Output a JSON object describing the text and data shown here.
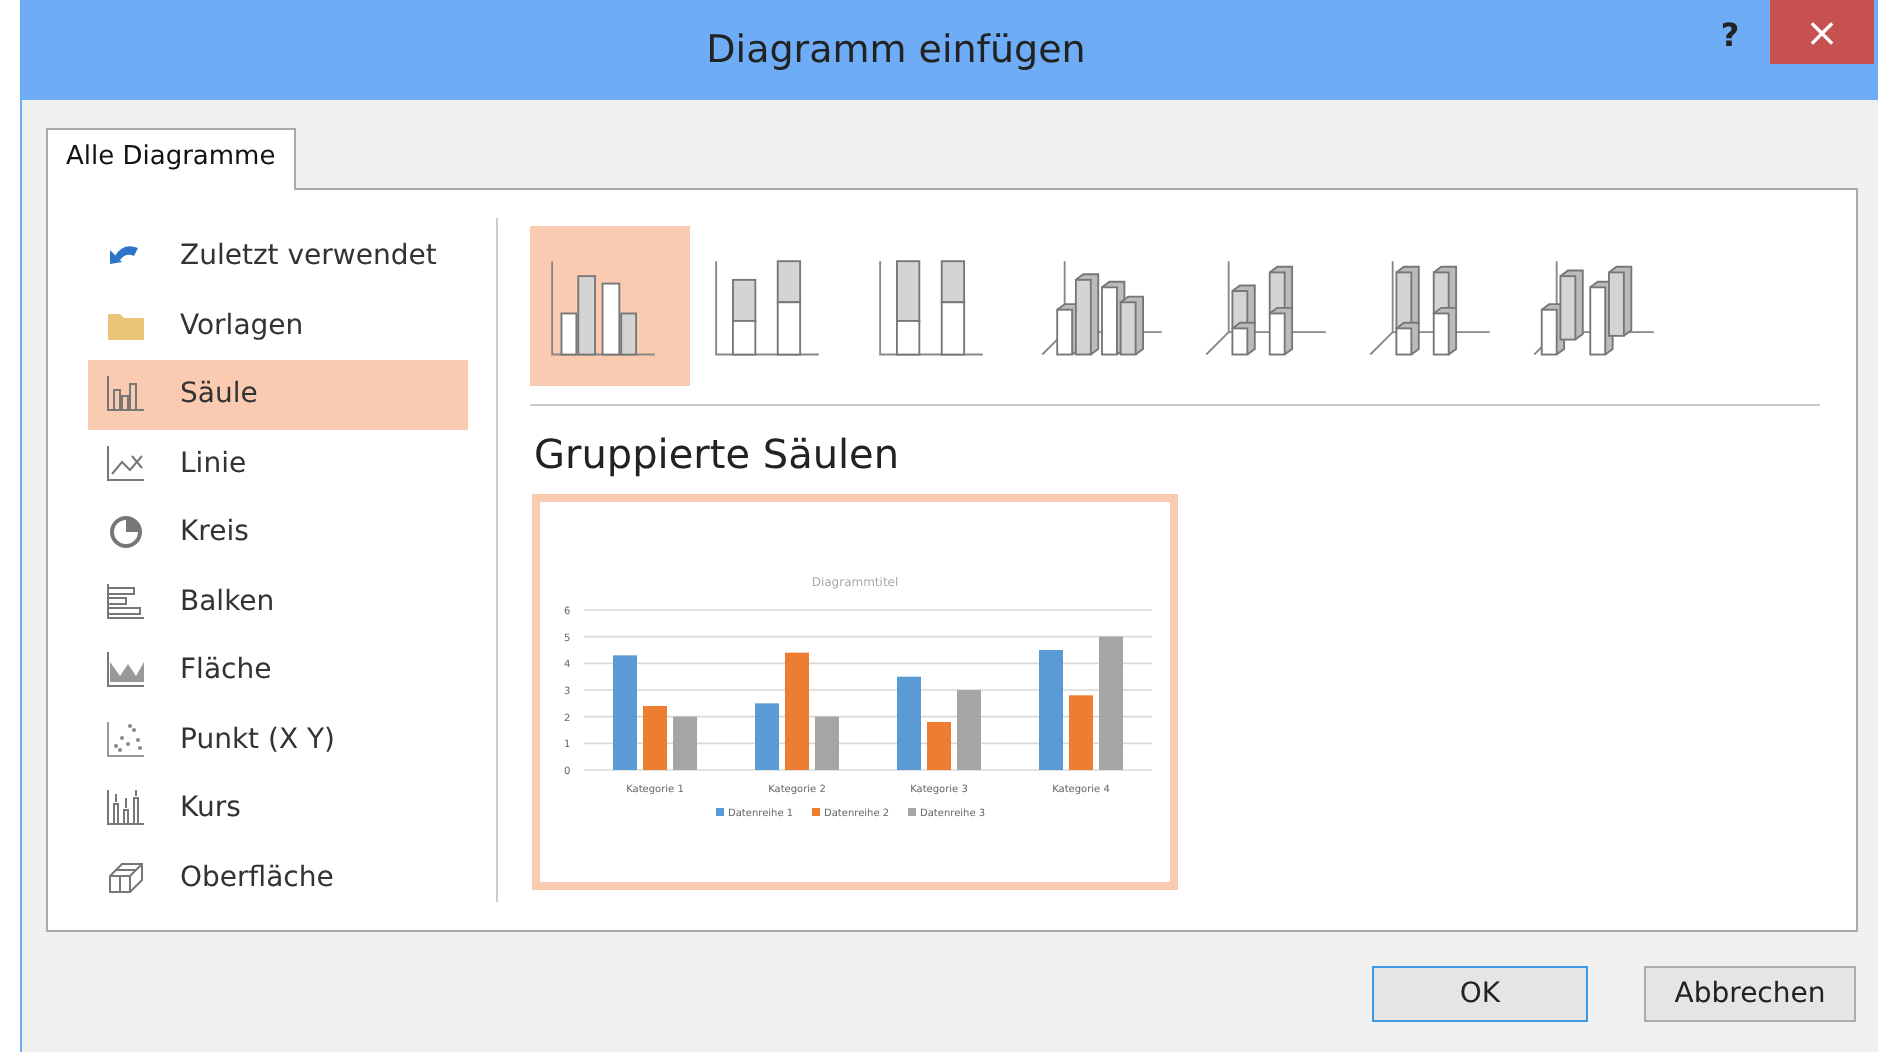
{
  "window": {
    "title": "Diagramm einfügen",
    "help": "?",
    "close": "×"
  },
  "tabs": [
    {
      "label": "Alle Diagramme",
      "selected": true
    }
  ],
  "categories": [
    {
      "kind": "recent",
      "label": "Zuletzt verwendet",
      "selected": false
    },
    {
      "kind": "templates",
      "label": "Vorlagen",
      "selected": false
    },
    {
      "kind": "column",
      "label": "Säule",
      "selected": true
    },
    {
      "kind": "line",
      "label": "Linie",
      "selected": false
    },
    {
      "kind": "pie",
      "label": "Kreis",
      "selected": false
    },
    {
      "kind": "bar",
      "label": "Balken",
      "selected": false
    },
    {
      "kind": "area",
      "label": "Fläche",
      "selected": false
    },
    {
      "kind": "scatter",
      "label": "Punkt (X Y)",
      "selected": false
    },
    {
      "kind": "stock",
      "label": "Kurs",
      "selected": false
    },
    {
      "kind": "surface",
      "label": "Oberfläche",
      "selected": false
    }
  ],
  "subtypes": [
    {
      "kind": "clustered",
      "selected": true
    },
    {
      "kind": "stacked",
      "selected": false
    },
    {
      "kind": "stacked100",
      "selected": false
    },
    {
      "kind": "clustered3d",
      "selected": false
    },
    {
      "kind": "stacked3d",
      "selected": false
    },
    {
      "kind": "stacked100_3d",
      "selected": false
    },
    {
      "kind": "column3d",
      "selected": false
    }
  ],
  "heading": "Gruppierte Säulen",
  "preview": {
    "chart_data": {
      "type": "bar",
      "title": "Diagrammtitel",
      "categories": [
        "Kategorie 1",
        "Kategorie 2",
        "Kategorie 3",
        "Kategorie 4"
      ],
      "series": [
        {
          "name": "Datenreihe 1",
          "color": "#5b9bd5",
          "values": [
            4.3,
            2.5,
            3.5,
            4.5
          ]
        },
        {
          "name": "Datenreihe 2",
          "color": "#ed7d31",
          "values": [
            2.4,
            4.4,
            1.8,
            2.8
          ]
        },
        {
          "name": "Datenreihe 3",
          "color": "#a5a5a5",
          "values": [
            2,
            2,
            3,
            5
          ]
        }
      ],
      "ylim": [
        0,
        6
      ],
      "yticks": [
        0,
        1,
        2,
        3,
        4,
        5,
        6
      ],
      "grid": true,
      "legend": "bottom"
    }
  },
  "buttons": [
    {
      "kind": "default",
      "label": "OK"
    },
    {
      "kind": "normal",
      "label": "Abbrechen"
    }
  ]
}
